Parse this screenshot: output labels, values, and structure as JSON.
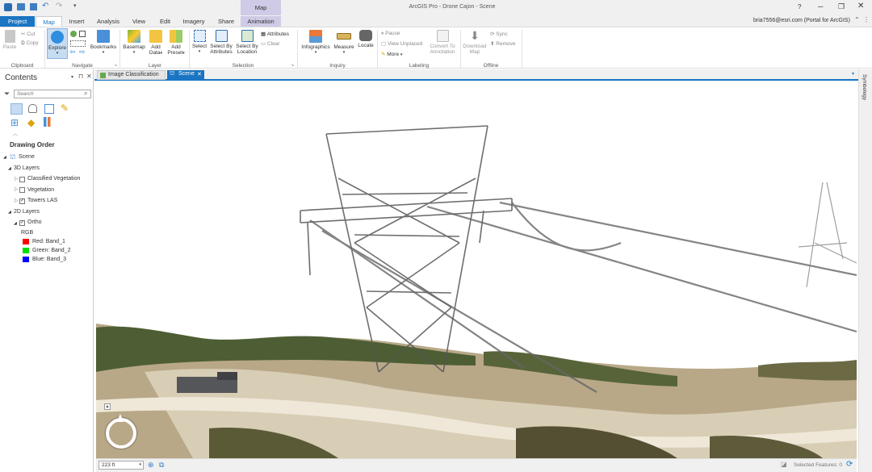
{
  "window": {
    "title": "ArcGIS Pro - Drone Cajon - Scene",
    "contextual_tab": "Map",
    "help": "?"
  },
  "tabs": [
    "Project",
    "Map",
    "Insert",
    "Analysis",
    "View",
    "Edit",
    "Imagery",
    "Share",
    "Animation"
  ],
  "active_tab": "Map",
  "user": "bria7556@esri.com (Portal for ArcGIS)",
  "ribbon": {
    "clipboard": {
      "paste": "Paste",
      "cut": "Cut",
      "copy": "Copy",
      "group": "Clipboard"
    },
    "navigate": {
      "explore": "Explore",
      "bookmarks": "Bookmarks",
      "group": "Navigate"
    },
    "layer": {
      "basemap": "Basemap",
      "add_data_1": "Add",
      "add_data_2": "Data",
      "add_preset_1": "Add",
      "add_preset_2": "Preset",
      "group": "Layer"
    },
    "selection": {
      "select": "Select",
      "by_attr_1": "Select By",
      "by_attr_2": "Attributes",
      "by_loc_1": "Select By",
      "by_loc_2": "Location",
      "attributes": "Attributes",
      "clear": "Clear",
      "group": "Selection"
    },
    "inquiry": {
      "infographics": "Infographics",
      "measure": "Measure",
      "locate": "Locate",
      "group": "Inquiry"
    },
    "labeling": {
      "pause": "Pause",
      "view_unplaced": "View Unplaced",
      "more": "More",
      "convert_1": "Convert To",
      "convert_2": "Annotation",
      "group": "Labeling"
    },
    "offline": {
      "download_1": "Download",
      "download_2": "Map",
      "sync": "Sync",
      "remove": "Remove",
      "group": "Offline"
    }
  },
  "contents": {
    "title": "Contents",
    "search_placeholder": "Search",
    "drawing_order": "Drawing Order",
    "scene": "Scene",
    "layers_3d": "3D Layers",
    "classified_vegetation": "Classified Vegetation",
    "vegetation": "Vegetation",
    "towers_las": "Towers LAS",
    "layers_2d": "2D Layers",
    "ortho": "Ortho",
    "rgb": "RGB",
    "bands": [
      {
        "label": "Red:  Band_1",
        "color": "#ff0000"
      },
      {
        "label": "Green: Band_2",
        "color": "#00dd00"
      },
      {
        "label": "Blue:  Band_3",
        "color": "#0000ff"
      }
    ]
  },
  "doc_tabs": [
    "Image Classification",
    "Scene"
  ],
  "active_doc": "Scene",
  "symbology": "Symbology",
  "status": {
    "scale": "223 ft",
    "selected": "Selected Features: 0"
  },
  "colors": {
    "accent": "#1a75c2",
    "project_tab": "#1a75c2",
    "contextual": "#cfcbe6"
  }
}
